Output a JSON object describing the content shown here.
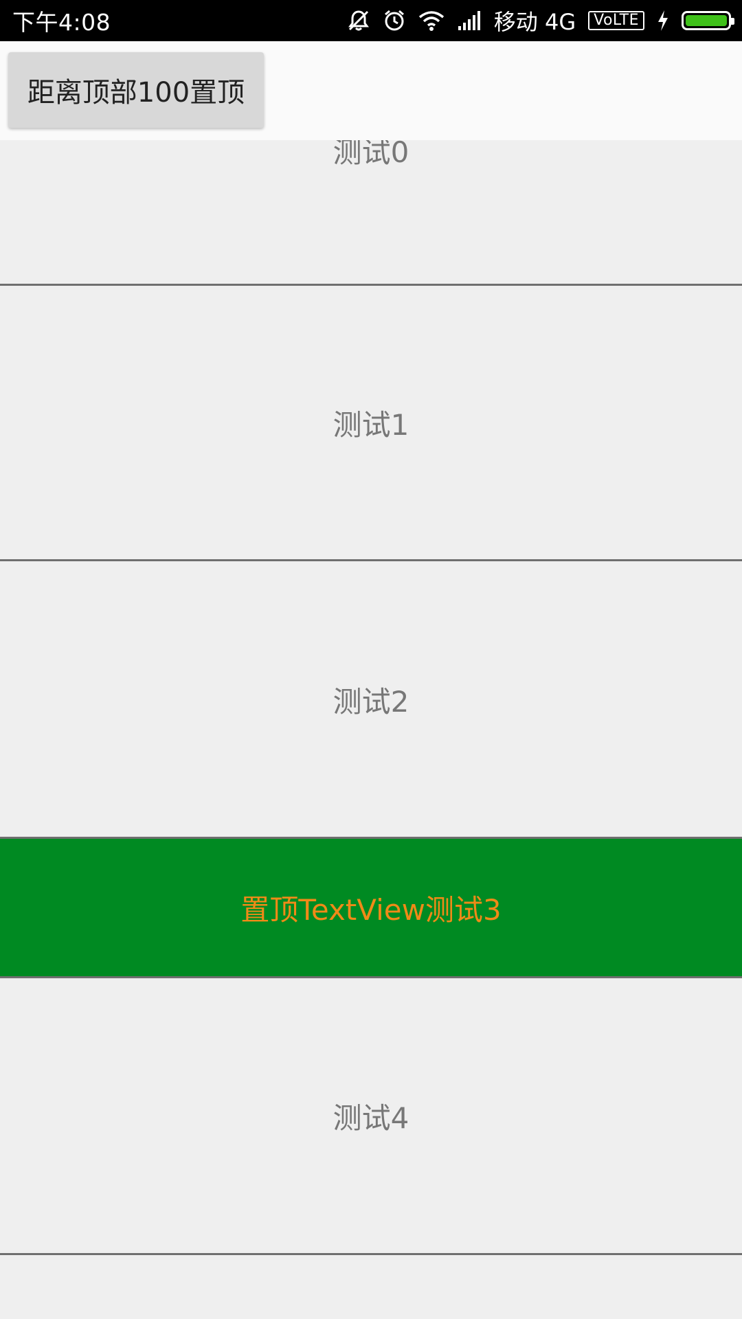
{
  "status_bar": {
    "time": "下午4:08",
    "icons": [
      "mute-vibrate-icon",
      "alarm-icon",
      "wifi-icon",
      "signal-icon"
    ],
    "carrier": "移动 4G",
    "volte": "VoLTE",
    "battery_color": "#3fc11a"
  },
  "toolbar": {
    "pin_button_label": "距离顶部100置顶"
  },
  "list": {
    "items": [
      {
        "label": "测试0"
      },
      {
        "label": "测试1"
      },
      {
        "label": "测试2"
      },
      {
        "label": "置顶TextView测试3"
      },
      {
        "label": "测试4"
      }
    ]
  },
  "colors": {
    "highlight_bg": "#008a22",
    "highlight_text": "#f08a17",
    "item_text": "#777777"
  }
}
